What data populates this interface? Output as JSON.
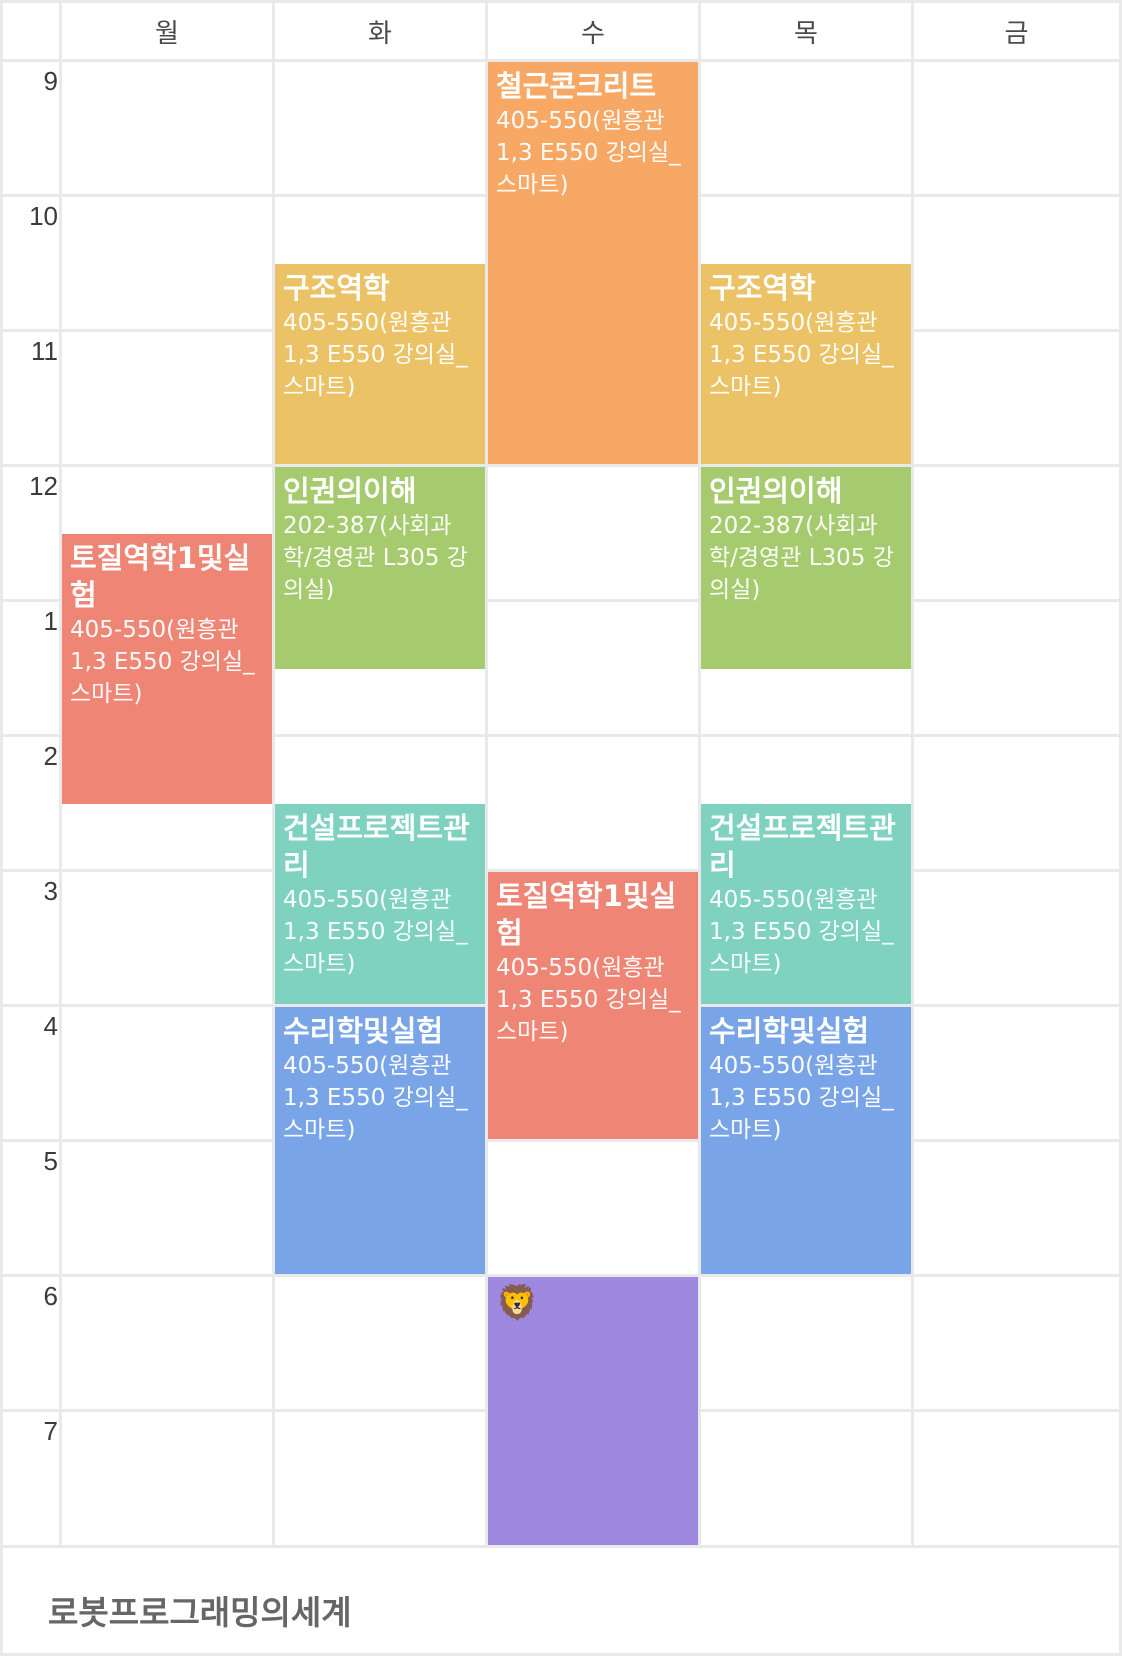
{
  "days": [
    "월",
    "화",
    "수",
    "목",
    "금"
  ],
  "hours": [
    "9",
    "10",
    "11",
    "12",
    "1",
    "2",
    "3",
    "4",
    "5",
    "6",
    "7"
  ],
  "colors": {
    "concrete": "#F7A865",
    "structure": "#EBC266",
    "humanrights": "#A6CA6E",
    "soil": "#EF8574",
    "project": "#7ED2BF",
    "hydraulics": "#79A5E8",
    "lion": "#9F88E0"
  },
  "events": {
    "wed_concrete": {
      "title": "철근콘크리트",
      "room": "405-550(원흥관 1,3 E550 강의실_스마트)"
    },
    "tue_structure": {
      "title": "구조역학",
      "room": "405-550(원흥관 1,3 E550 강의실_스마트)"
    },
    "thu_structure": {
      "title": "구조역학",
      "room": "405-550(원흥관 1,3 E550 강의실_스마트)"
    },
    "tue_humanrights": {
      "title": "인권의이해",
      "room": "202-387(사회과학/경영관 L305 강의실)"
    },
    "thu_humanrights": {
      "title": "인권의이해",
      "room": "202-387(사회과학/경영관 L305 강의실)"
    },
    "mon_soil": {
      "title": "토질역학1및실험",
      "room": "405-550(원흥관 1,3 E550 강의실_스마트)"
    },
    "tue_project": {
      "title": "건설프로젝트관리",
      "room": "405-550(원흥관 1,3 E550 강의실_스마트)"
    },
    "thu_project": {
      "title": "건설프로젝트관리",
      "room": "405-550(원흥관 1,3 E550 강의실_스마트)"
    },
    "wed_soil": {
      "title": "토질역학1및실험",
      "room": "405-550(원흥관 1,3 E550 강의실_스마트)"
    },
    "tue_hydraulics": {
      "title": "수리학및실험",
      "room": "405-550(원흥관 1,3 E550 강의실_스마트)"
    },
    "thu_hydraulics": {
      "title": "수리학및실험",
      "room": "405-550(원흥관 1,3 E550 강의실_스마트)"
    },
    "wed_lion": {
      "emoji": "🦁"
    }
  },
  "footer": {
    "course": "로봇프로그래밍의세계"
  }
}
